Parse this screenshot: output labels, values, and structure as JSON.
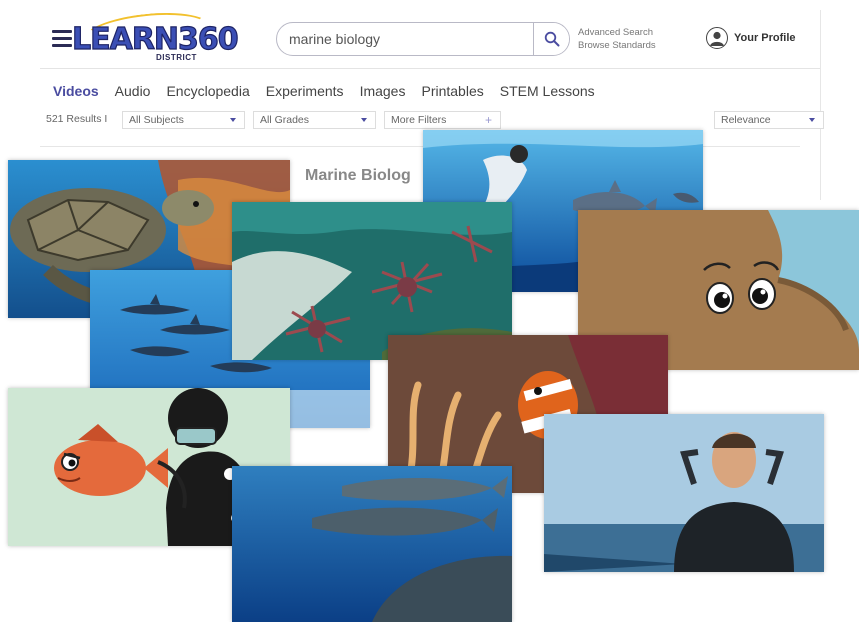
{
  "header": {
    "logo_text": "LEARN360",
    "logo_sub": "DISTRICT",
    "search": {
      "value": "marine biology"
    },
    "advanced_search": "Advanced Search",
    "browse_standards": "Browse Standards",
    "profile_label": "Your Profile"
  },
  "tabs": [
    {
      "label": "Videos",
      "active": true
    },
    {
      "label": "Audio"
    },
    {
      "label": "Encyclopedia"
    },
    {
      "label": "Experiments"
    },
    {
      "label": "Images"
    },
    {
      "label": "Printables"
    },
    {
      "label": "STEM Lessons"
    }
  ],
  "filters": {
    "results": "521 Results I",
    "subjects": "All Subjects",
    "grades": "All Grades",
    "more": "More Filters",
    "sort": "Relevance"
  },
  "section_title": "Marine Biolog",
  "colors": {
    "accent": "#4a4ca0",
    "logo_blue": "#3b4fb5",
    "logo_gold": "#f2c12e",
    "ocean_deep": "#0b3f86",
    "ocean_light": "#3f9fd8",
    "clownfish": "#e0641c",
    "octopus": "#a47b4f"
  },
  "icons": {
    "menu": "hamburger-icon",
    "search": "search-icon",
    "profile": "user-avatar-icon",
    "dropdown": "caret-down-icon",
    "add": "plus-icon"
  }
}
